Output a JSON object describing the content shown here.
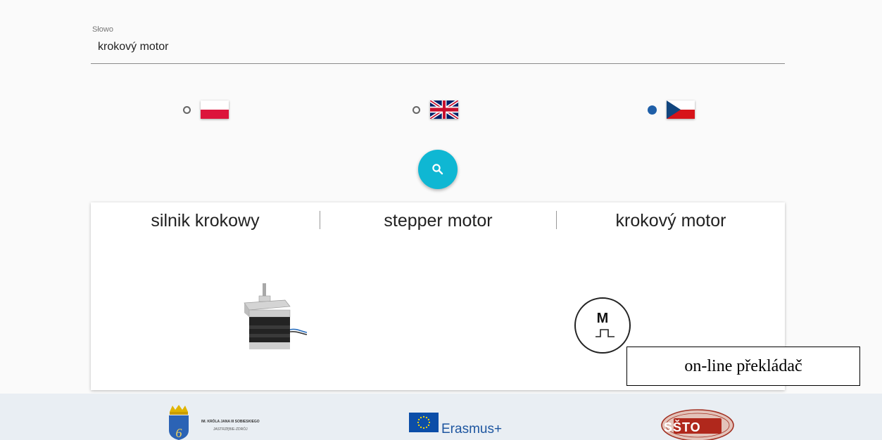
{
  "search": {
    "label": "Słowo",
    "value": "krokový motor"
  },
  "languages": [
    {
      "code": "pl",
      "selected": false
    },
    {
      "code": "en",
      "selected": false
    },
    {
      "code": "cz",
      "selected": true
    }
  ],
  "accent_color": "#0fb7d3",
  "selected_radio_color": "#1f5fa8",
  "search_button": {
    "icon": "search-icon"
  },
  "results": {
    "polish": "silnik krokowy",
    "english": "stepper motor",
    "czech": "krokový motor"
  },
  "motor_symbol_letter": "M",
  "callout": "on-line překládač",
  "footer": {
    "school_name": "IM. KRÓLA JANA III SOBIESKIEGO",
    "school_city": "JASTRZĘBIE-ZDRÓJ",
    "school_crest_number": "6",
    "erasmus_text": "Erasmus+",
    "ssto_text": "SŠTO"
  }
}
